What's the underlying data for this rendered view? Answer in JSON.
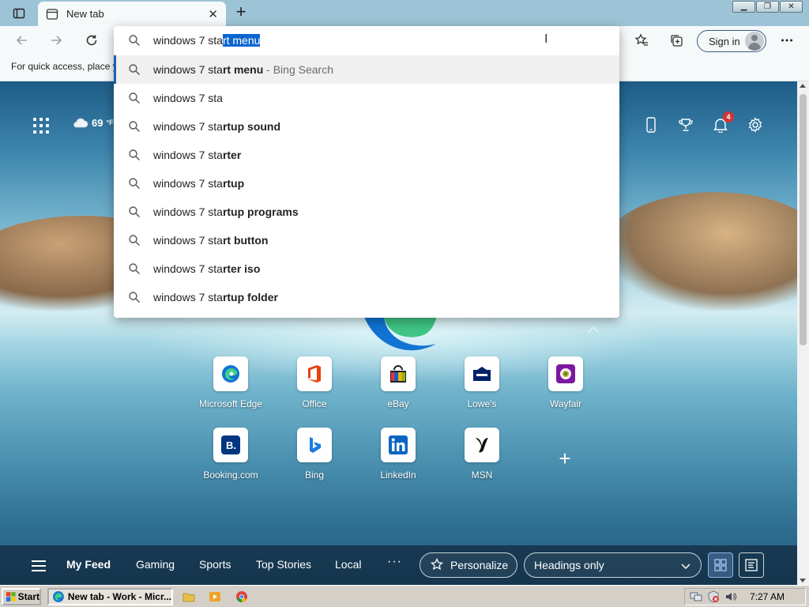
{
  "tab": {
    "title": "New tab"
  },
  "address": {
    "typed_prefix": "windows 7 sta",
    "typed_selected": "rt menu"
  },
  "toolbar": {
    "signin_label": "Sign in"
  },
  "favorites_bar": {
    "hint": "For quick access, place y"
  },
  "suggestions": [
    {
      "prefix": "windows 7 sta",
      "bold": "rt menu",
      "source": " - Bing Search",
      "highlighted": true
    },
    {
      "prefix": "windows 7 sta",
      "bold": "",
      "source": ""
    },
    {
      "prefix": "windows 7 sta",
      "bold": "rtup sound",
      "source": ""
    },
    {
      "prefix": "windows 7 sta",
      "bold": "rter",
      "source": ""
    },
    {
      "prefix": "windows 7 sta",
      "bold": "rtup",
      "source": ""
    },
    {
      "prefix": "windows 7 sta",
      "bold": "rtup programs",
      "source": ""
    },
    {
      "prefix": "windows 7 sta",
      "bold": "rt button",
      "source": ""
    },
    {
      "prefix": "windows 7 sta",
      "bold": "rter iso",
      "source": ""
    },
    {
      "prefix": "windows 7 sta",
      "bold": "rtup folder",
      "source": ""
    }
  ],
  "ntp": {
    "weather": {
      "temp": "69",
      "unit": "°F"
    },
    "notifications_count": "4",
    "quick_links": [
      {
        "label": "Microsoft Edge",
        "icon": "edge-icon"
      },
      {
        "label": "Office",
        "icon": "office-icon"
      },
      {
        "label": "eBay",
        "icon": "ebay-icon"
      },
      {
        "label": "Lowe's",
        "icon": "lowes-icon"
      },
      {
        "label": "Wayfair",
        "icon": "wayfair-icon"
      },
      {
        "label": "Booking.com",
        "icon": "booking-icon"
      },
      {
        "label": "Bing",
        "icon": "bing-icon"
      },
      {
        "label": "LinkedIn",
        "icon": "linkedin-icon"
      },
      {
        "label": "MSN",
        "icon": "msn-icon"
      }
    ]
  },
  "feed": {
    "tabs": [
      "My Feed",
      "Gaming",
      "Sports",
      "Top Stories",
      "Local"
    ],
    "more": "···",
    "personalize_label": "Personalize",
    "headings_label": "Headings only"
  },
  "taskbar": {
    "start_label": "Start",
    "task_label": "New tab - Work - Micr...",
    "clock": "7:27 AM"
  },
  "colors": {
    "accent": "#0a64d0",
    "badge": "#d13438",
    "signin_border": "#3a5a88"
  }
}
